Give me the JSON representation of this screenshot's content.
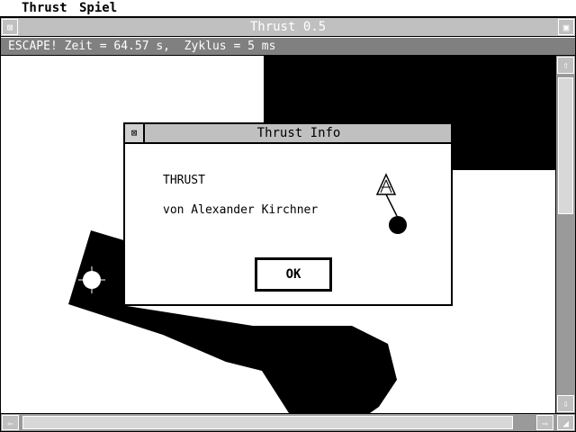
{
  "menubar": {
    "items": [
      "Thrust",
      "Spiel"
    ]
  },
  "window": {
    "title": "Thrust 0.5",
    "info": "ESCAPE! Zeit = 64.57 s,  Zyklus = 5 ms"
  },
  "dialog": {
    "title": "Thrust Info",
    "line1": "THRUST",
    "line2": "von Alexander Kirchner",
    "ok_label": "OK"
  },
  "icons": {
    "window_close": "close-box-icon",
    "window_full": "full-box-icon",
    "dialog_close": "close-box-icon",
    "scroll_up": "arrow-up-icon",
    "scroll_down": "arrow-down-icon",
    "scroll_left": "arrow-left-icon",
    "scroll_right": "arrow-right-icon",
    "ship": "ship-icon",
    "pod": "pod-icon"
  },
  "colors": {
    "title_background": "#c0c0c0",
    "info_background": "#808080",
    "terrain": "#000000"
  }
}
